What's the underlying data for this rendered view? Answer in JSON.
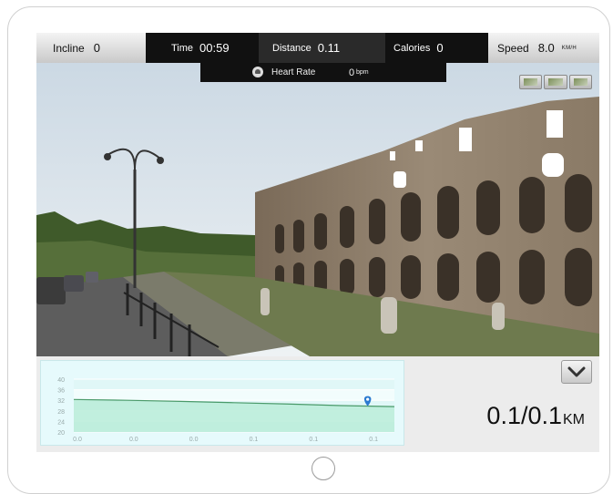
{
  "hud": {
    "incline_label": "Incline",
    "incline_value": "0",
    "time_label": "Time",
    "time_value": "00:59",
    "distance_label": "Distance",
    "distance_value": "0.11",
    "calories_label": "Calories",
    "calories_value": "0",
    "speed_label": "Speed",
    "speed_value": "8.0",
    "speed_unit": "KM/H",
    "heart_rate_label": "Heart Rate",
    "heart_rate_value": "0",
    "heart_rate_unit": "bpm"
  },
  "readout": {
    "distance": "0.1/0.1",
    "unit": "KM"
  },
  "icons": {
    "heart": "heart-rate-icon",
    "collapse": "chevron-down-icon"
  },
  "colors": {
    "hud_dark": "#111111",
    "chart_bg": "#e6fafc",
    "elevation_line": "#4a9a6a",
    "marker": "#2a7ad0"
  },
  "chart_data": {
    "type": "area",
    "x_tick_labels": [
      "0.0",
      "0.0",
      "0.0",
      "0.1",
      "0.1",
      "0.1"
    ],
    "y_tick_labels": [
      "40",
      "36",
      "32",
      "28",
      "24",
      "20"
    ],
    "ylim": [
      20,
      40
    ],
    "x": [
      0.0,
      0.02,
      0.04,
      0.06,
      0.08,
      0.1,
      0.12
    ],
    "values": [
      32.3,
      32.0,
      31.6,
      31.1,
      30.6,
      30.0,
      29.6
    ],
    "marker_x": 0.11,
    "marker_y": 29.8,
    "grid": true
  }
}
